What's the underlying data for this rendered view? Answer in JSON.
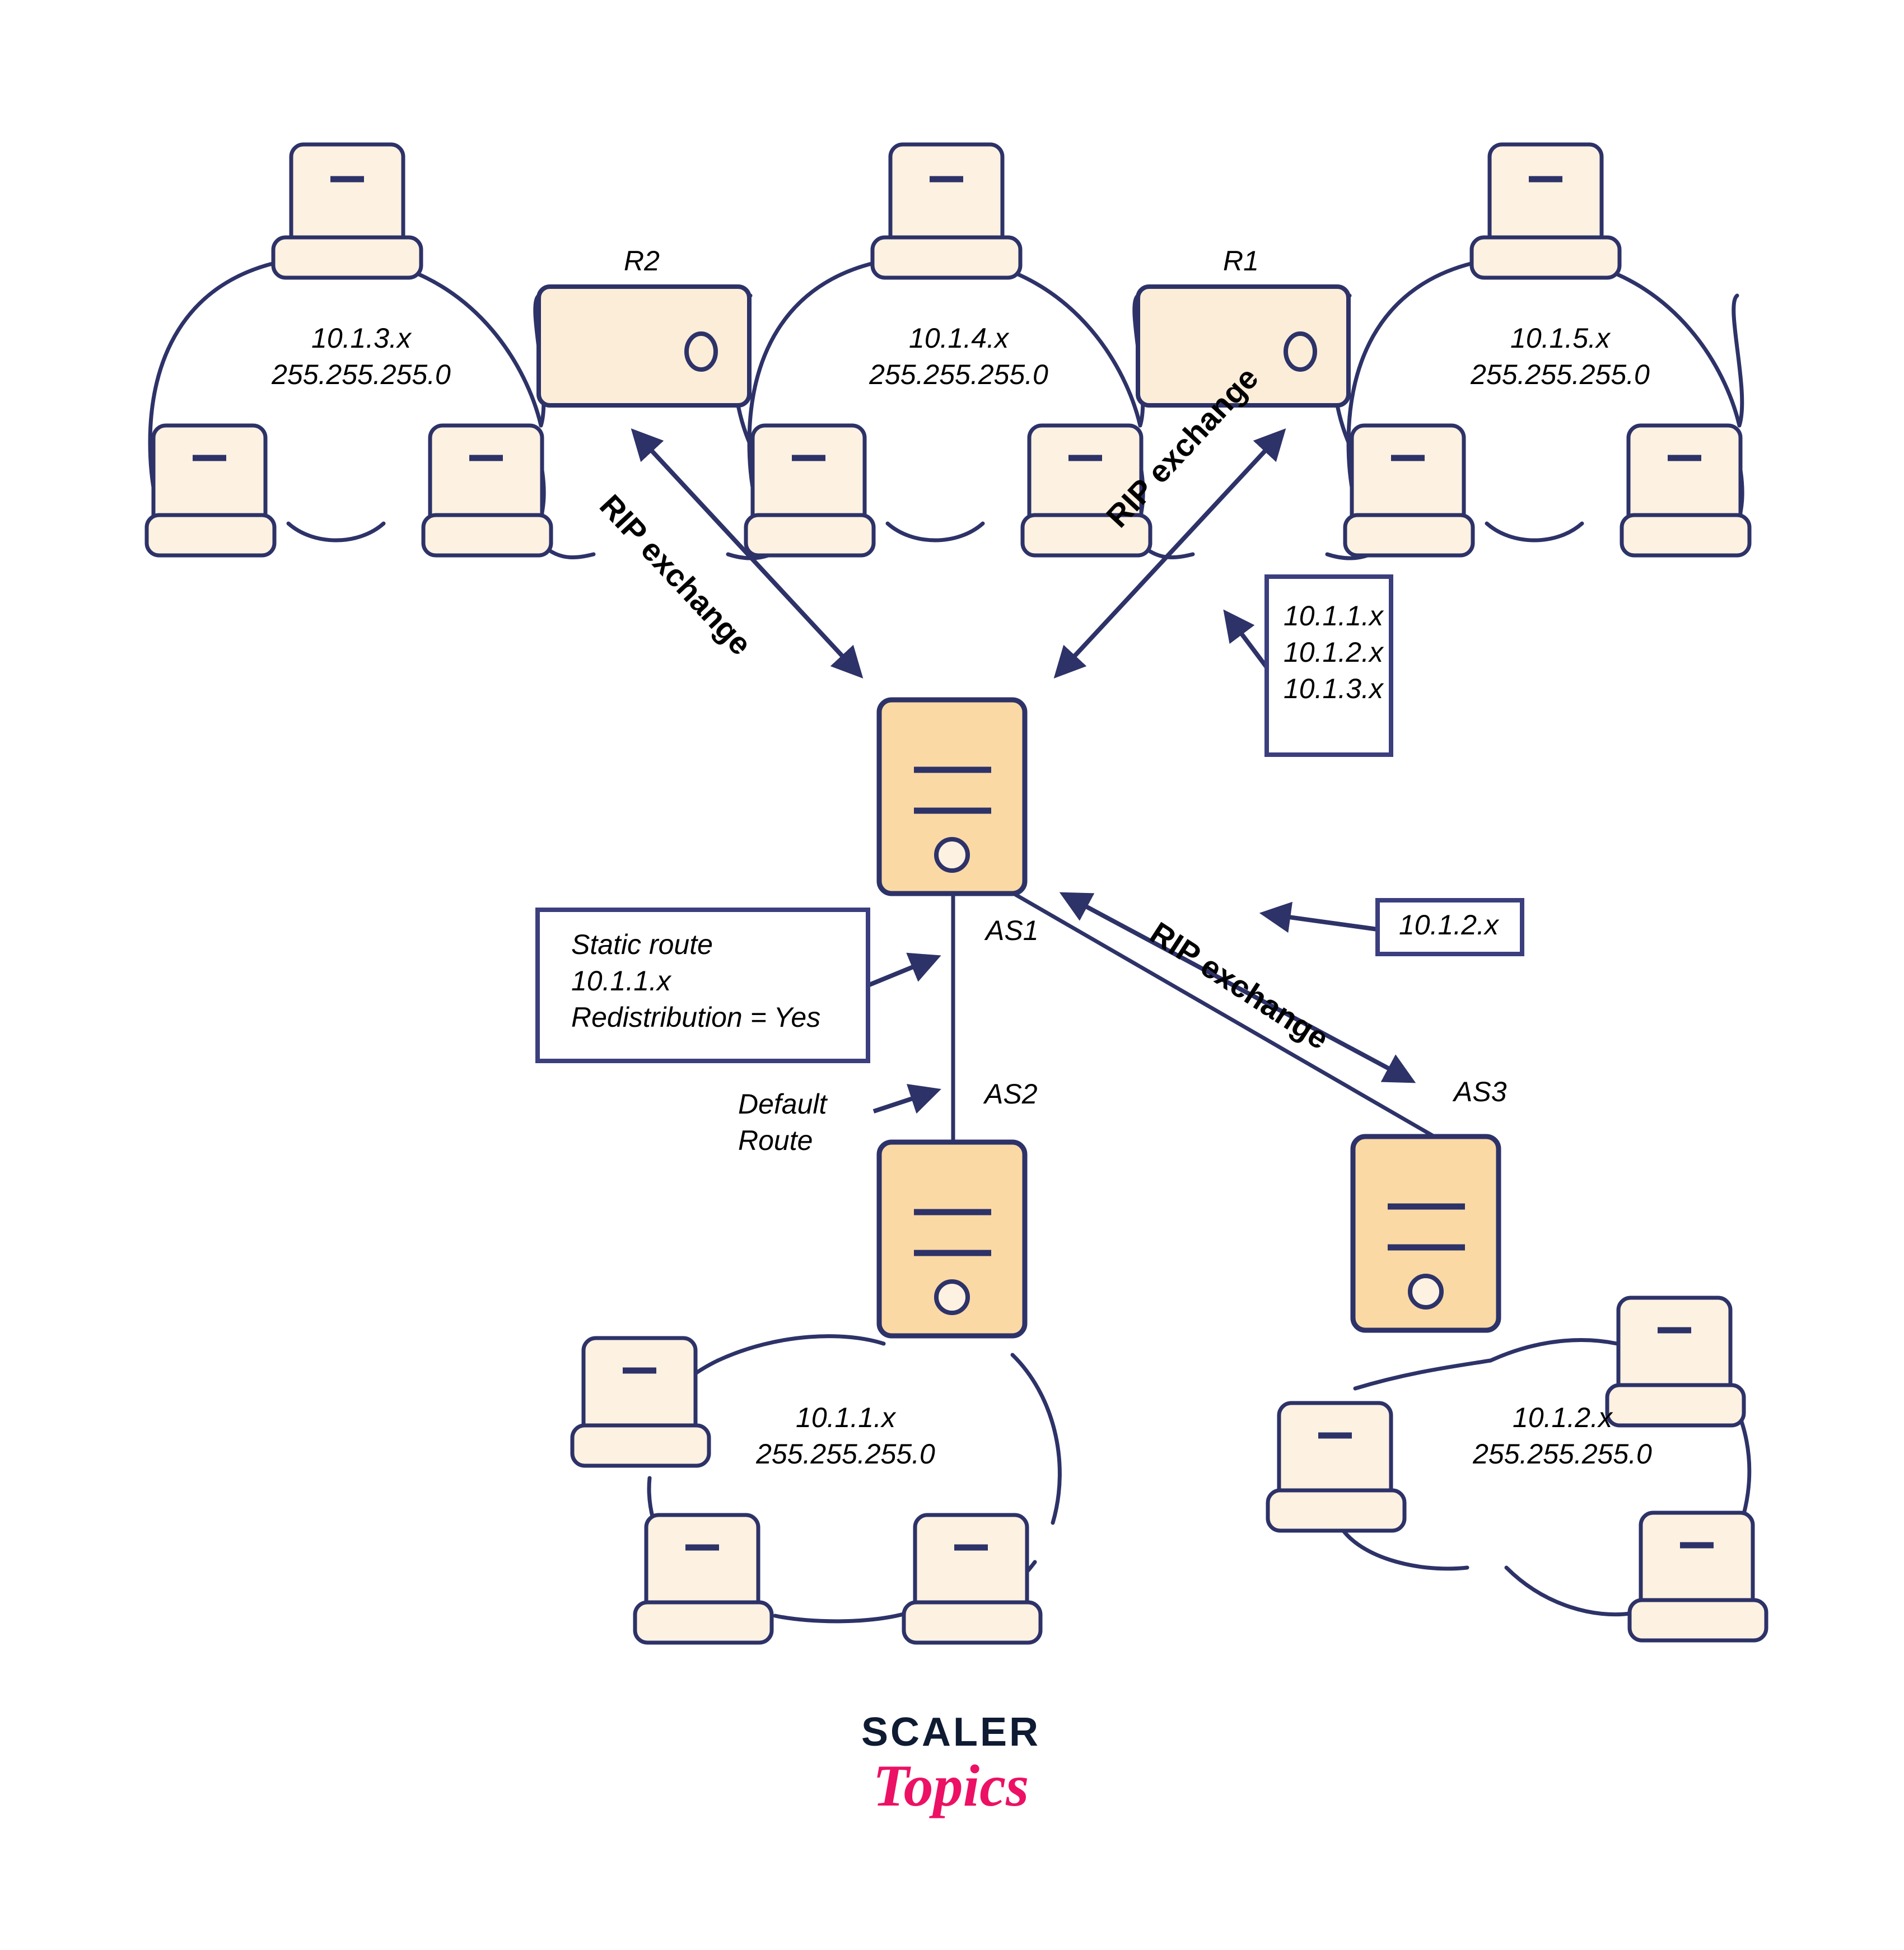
{
  "diagram": {
    "title": "RIP redistribution network topology",
    "colors": {
      "stroke": "#2D3268",
      "laptop_fill": "#FDF1E1",
      "router_fill": "#FCEDD9",
      "server_fill": "#FBD9A5",
      "logo_dark": "#0E1B33",
      "logo_pink": "#EC1164",
      "background": "#FFFFFF"
    },
    "networks": [
      {
        "id": "net-10-1-3",
        "address": "10.1.3.x",
        "mask": "255.255.255.0"
      },
      {
        "id": "net-10-1-4",
        "address": "10.1.4.x",
        "mask": "255.255.255.0"
      },
      {
        "id": "net-10-1-5",
        "address": "10.1.5.x",
        "mask": "255.255.255.0"
      },
      {
        "id": "net-10-1-1",
        "address": "10.1.1.x",
        "mask": "255.255.255.0"
      },
      {
        "id": "net-10-1-2",
        "address": "10.1.2.x",
        "mask": "255.255.255.0"
      }
    ],
    "routers": [
      {
        "id": "r2",
        "label": "R2"
      },
      {
        "id": "r1",
        "label": "R1"
      }
    ],
    "servers": [
      {
        "id": "as1",
        "label": "AS1"
      },
      {
        "id": "as2",
        "label": "AS2"
      },
      {
        "id": "as3",
        "label": "AS3"
      }
    ],
    "rip_labels": [
      {
        "id": "rip-left",
        "text": "RIP exchange"
      },
      {
        "id": "rip-right",
        "text": "RIP exchange"
      },
      {
        "id": "rip-as3",
        "text": "RIP exchange"
      }
    ],
    "callouts": {
      "routes_box": {
        "lines": [
          "10.1.1.x",
          "10.1.2.x",
          "10.1.3.x"
        ]
      },
      "static_route_box": {
        "lines": [
          "Static route",
          "10.1.1.x",
          "Redistribution = Yes"
        ]
      },
      "advertised_box": {
        "text": "10.1.2.x"
      },
      "default_route": {
        "line1": "Default",
        "line2": "Route"
      }
    },
    "logo": {
      "primary": "SCALER",
      "secondary": "Topics"
    }
  }
}
